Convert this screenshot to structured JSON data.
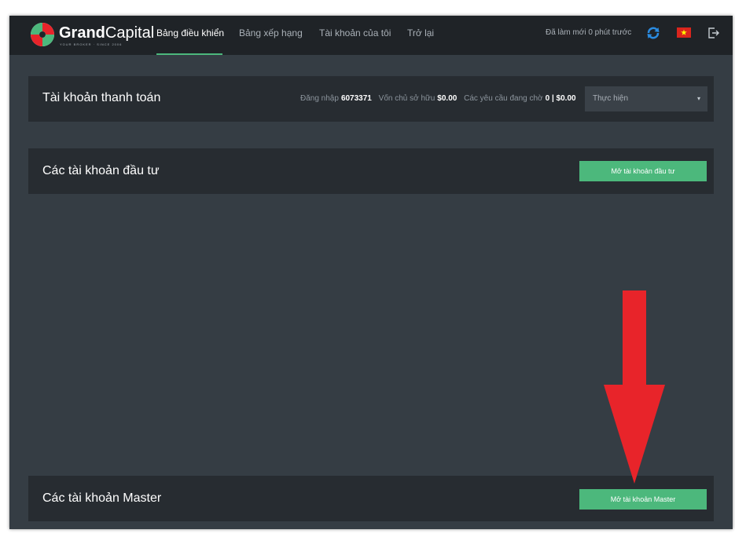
{
  "brand": {
    "name_bold": "Grand",
    "name_thin": "Capital",
    "tagline": "YOUR BROKER · SINCE 2006"
  },
  "nav": {
    "items": [
      {
        "label": "Bảng điều khiển",
        "active": true
      },
      {
        "label": "Bảng xếp hạng",
        "active": false
      },
      {
        "label": "Tài khoản của tôi",
        "active": false
      },
      {
        "label": "Trở lại",
        "active": false
      }
    ],
    "refresh_status": "Đã làm mới 0 phút trước",
    "icons": [
      "refresh-icon",
      "vietnam-flag-icon",
      "logout-icon"
    ]
  },
  "payment_account": {
    "title": "Tài khoản thanh toán",
    "login_label": "Đăng nhập",
    "login_value": "6073371",
    "equity_label": "Vốn chủ sở hữu",
    "equity_value": "$0.00",
    "pending_label": "Các yêu cầu đang chờ",
    "pending_value": "0 | $0.00",
    "action_select": "Thực hiện"
  },
  "investor_accounts": {
    "title": "Các tài khoản đầu tư",
    "open_button": "Mở tài khoản đầu tư"
  },
  "master_accounts": {
    "title": "Các tài khoản Master",
    "open_button": "Mở tài khoản Master"
  },
  "colors": {
    "accent_green": "#4cb87c",
    "background": "#353d44",
    "panel": "#272c31",
    "nav": "#1f2327",
    "arrow_red": "#e8242a"
  }
}
